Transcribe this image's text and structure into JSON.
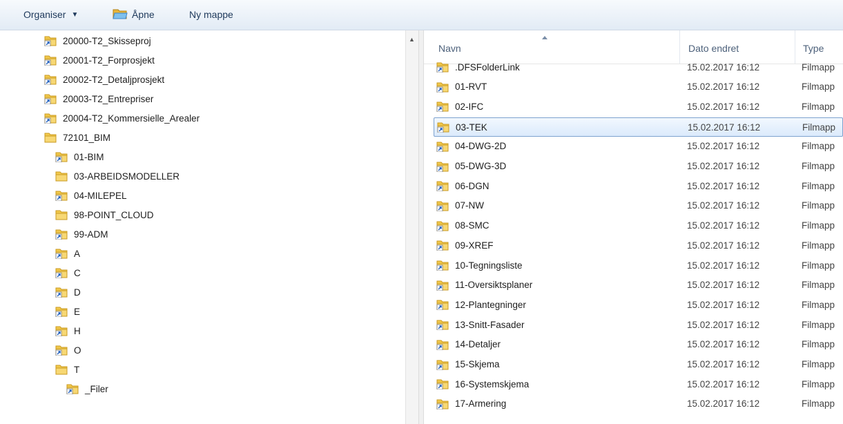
{
  "toolbar": {
    "organise": "Organiser",
    "open": "Åpne",
    "new_folder": "Ny mappe"
  },
  "tree": [
    {
      "label": "20000-T2_Skisseproj",
      "icon": "folder-shortcut-icon"
    },
    {
      "label": "20001-T2_Forprosjekt",
      "icon": "folder-shortcut-icon"
    },
    {
      "label": "20002-T2_Detaljprosjekt",
      "icon": "folder-shortcut-icon"
    },
    {
      "label": "20003-T2_Entrepriser",
      "icon": "folder-shortcut-icon"
    },
    {
      "label": "20004-T2_Kommersielle_Arealer",
      "icon": "folder-shortcut-icon"
    },
    {
      "label": "72101_BIM",
      "icon": "folder-icon"
    },
    {
      "label": "01-BIM",
      "icon": "folder-shortcut-icon"
    },
    {
      "label": "03-ARBEIDSMODELLER",
      "icon": "folder-icon"
    },
    {
      "label": "04-MILEPEL",
      "icon": "folder-shortcut-icon"
    },
    {
      "label": "98-POINT_CLOUD",
      "icon": "folder-icon"
    },
    {
      "label": "99-ADM",
      "icon": "folder-shortcut-icon"
    },
    {
      "label": "A",
      "icon": "folder-shortcut-icon"
    },
    {
      "label": "C",
      "icon": "folder-shortcut-icon"
    },
    {
      "label": "D",
      "icon": "folder-shortcut-icon"
    },
    {
      "label": "E",
      "icon": "folder-shortcut-icon"
    },
    {
      "label": "H",
      "icon": "folder-shortcut-icon"
    },
    {
      "label": "O",
      "icon": "folder-shortcut-icon"
    },
    {
      "label": "T",
      "icon": "folder-icon"
    },
    {
      "label": "_Filer",
      "icon": "folder-shortcut-icon"
    }
  ],
  "columns": {
    "name": "Navn",
    "date": "Dato endret",
    "type": "Type"
  },
  "files": [
    {
      "name": ".DFSFolderLink",
      "date": "15.02.2017 16:12",
      "type": "Filmapp"
    },
    {
      "name": "01-RVT",
      "date": "15.02.2017 16:12",
      "type": "Filmapp"
    },
    {
      "name": "02-IFC",
      "date": "15.02.2017 16:12",
      "type": "Filmapp"
    },
    {
      "name": "03-TEK",
      "date": "15.02.2017 16:12",
      "type": "Filmapp"
    },
    {
      "name": "04-DWG-2D",
      "date": "15.02.2017 16:12",
      "type": "Filmapp"
    },
    {
      "name": "05-DWG-3D",
      "date": "15.02.2017 16:12",
      "type": "Filmapp"
    },
    {
      "name": "06-DGN",
      "date": "15.02.2017 16:12",
      "type": "Filmapp"
    },
    {
      "name": "07-NW",
      "date": "15.02.2017 16:12",
      "type": "Filmapp"
    },
    {
      "name": "08-SMC",
      "date": "15.02.2017 16:12",
      "type": "Filmapp"
    },
    {
      "name": "09-XREF",
      "date": "15.02.2017 16:12",
      "type": "Filmapp"
    },
    {
      "name": "10-Tegningsliste",
      "date": "15.02.2017 16:12",
      "type": "Filmapp"
    },
    {
      "name": "11-Oversiktsplaner",
      "date": "15.02.2017 16:12",
      "type": "Filmapp"
    },
    {
      "name": "12-Plantegninger",
      "date": "15.02.2017 16:12",
      "type": "Filmapp"
    },
    {
      "name": "13-Snitt-Fasader",
      "date": "15.02.2017 16:12",
      "type": "Filmapp"
    },
    {
      "name": "14-Detaljer",
      "date": "15.02.2017 16:12",
      "type": "Filmapp"
    },
    {
      "name": "15-Skjema",
      "date": "15.02.2017 16:12",
      "type": "Filmapp"
    },
    {
      "name": "16-Systemskjema",
      "date": "15.02.2017 16:12",
      "type": "Filmapp"
    },
    {
      "name": "17-Armering",
      "date": "15.02.2017 16:12",
      "type": "Filmapp"
    }
  ],
  "selected_file": "03-TEK",
  "colors": {
    "toolbar_text": "#1e395b",
    "selection_border": "#7da2ce",
    "folder_yellow": "#f2c94c",
    "shortcut_arrow": "#1f5fbf"
  }
}
